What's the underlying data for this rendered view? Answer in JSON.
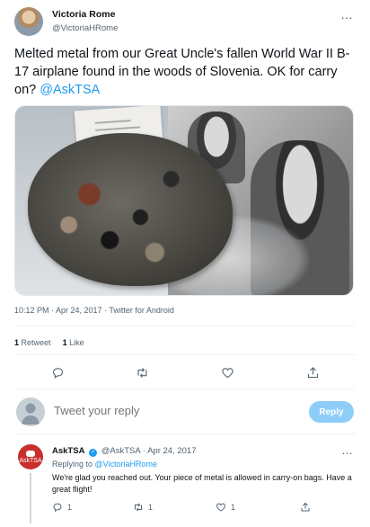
{
  "tweet": {
    "author_name": "Victoria Rome",
    "author_handle": "@VictoriaHRome",
    "more": "…",
    "text_main": "Melted metal from our Great Uncle's fallen World War II B-17 airplane found in the woods of Slovenia. OK for carry on? ",
    "text_mention": "@AskTSA",
    "meta": "10:12 PM · Apr 24, 2017 · Twitter for Android",
    "retweets_count": "1",
    "retweets_label": "Retweet",
    "likes_count": "1",
    "likes_label": "Like"
  },
  "actions": {
    "reply_icon": "reply-icon",
    "retweet_icon": "retweet-icon",
    "like_icon": "heart-icon",
    "share_icon": "share-icon"
  },
  "compose": {
    "placeholder": "Tweet your reply",
    "button_label": "Reply"
  },
  "reply": {
    "author_name": "AskTSA",
    "author_handle": "@AskTSA",
    "date": "· Apr 24, 2017",
    "more": "…",
    "replying_prefix": "Replying to ",
    "replying_handle": "@VictoriaHRome",
    "text": "We're glad you reached out. Your piece of metal is allowed in carry-on bags. Have a great flight!",
    "avatar_text": "AskTSA",
    "reply_count": "1",
    "retweet_count": "1",
    "like_count": "1"
  },
  "colors": {
    "accent": "#1d9bf0",
    "text_primary": "#0f1419",
    "text_secondary": "#536471",
    "reply_button": "#8ecdf8",
    "tsa_red": "#c8302d"
  }
}
